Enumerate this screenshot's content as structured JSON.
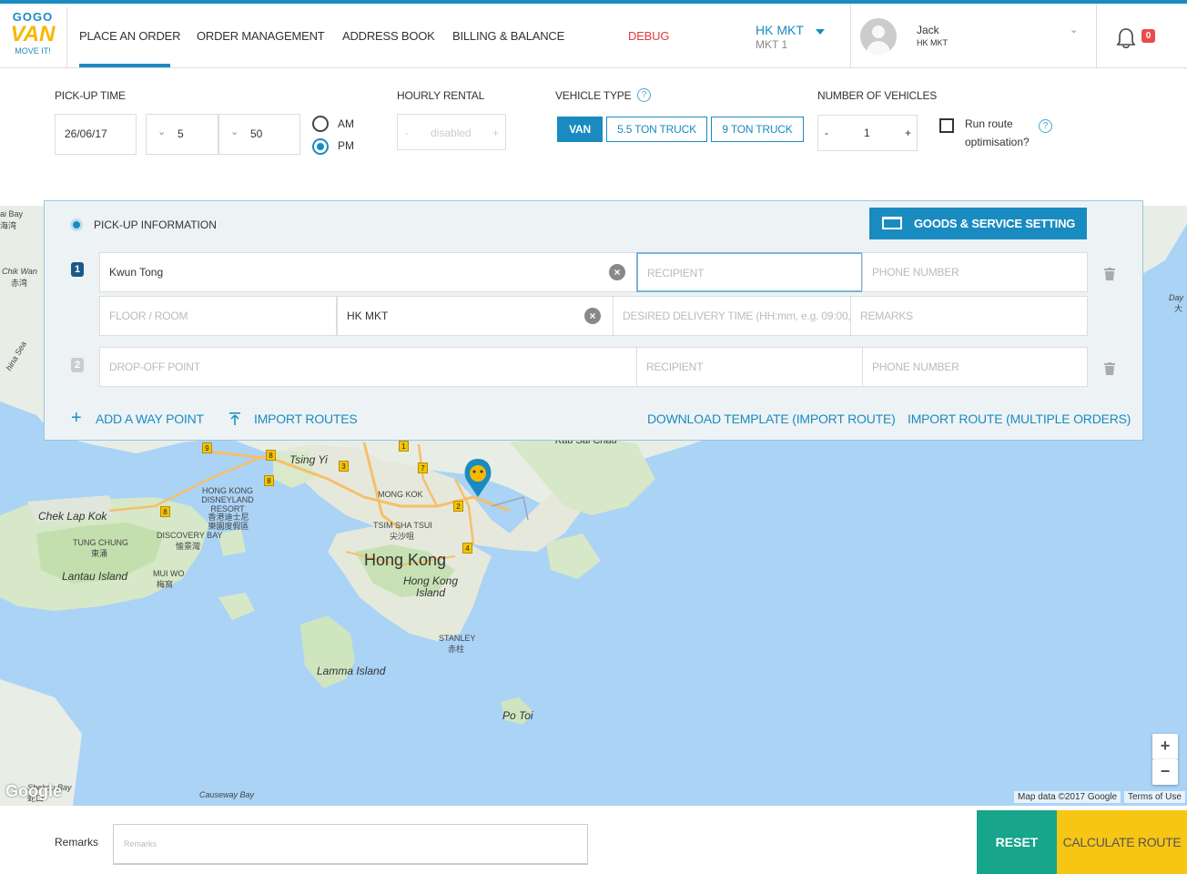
{
  "header": {
    "logo": {
      "line1": "GOGO",
      "line2": "VAN",
      "line3": "MOVE IT!"
    },
    "nav": [
      {
        "label": "PLACE AN ORDER"
      },
      {
        "label": "ORDER MANAGEMENT"
      },
      {
        "label": "ADDRESS BOOK"
      },
      {
        "label": "BILLING & BALANCE"
      },
      {
        "label": "DEBUG"
      }
    ],
    "market": {
      "name": "HK MKT",
      "sub": "MKT 1"
    },
    "user": {
      "name": "Jack",
      "sub": "HK MKT"
    },
    "notifications": "0"
  },
  "order_form": {
    "pickup_time": {
      "label": "PICK-UP TIME",
      "date": "26/06/17",
      "hour": "5",
      "minute": "50",
      "am_label": "AM",
      "pm_label": "PM",
      "selected": "PM"
    },
    "hourly_rental": {
      "label": "HOURLY RENTAL",
      "minus": "-",
      "value": "disabled",
      "plus": "+"
    },
    "vehicle_type": {
      "label": "VEHICLE TYPE",
      "options": [
        {
          "label": "VAN",
          "selected": true
        },
        {
          "label": "5.5 TON TRUCK",
          "selected": false
        },
        {
          "label": "9 TON TRUCK",
          "selected": false
        }
      ]
    },
    "vehicles": {
      "label": "NUMBER OF VEHICLES",
      "minus": "-",
      "value": "1",
      "plus": "+"
    },
    "route_opt": {
      "line1": "Run route",
      "line2": "optimisation?",
      "checked": false
    },
    "help": "?"
  },
  "pickup_panel": {
    "title": "PICK-UP INFORMATION",
    "goods_button": "GOODS & SERVICE SETTING",
    "stop1": {
      "number": "1",
      "address": "Kwun Tong",
      "recipient_placeholder": "RECIPIENT",
      "phone_placeholder": "PHONE NUMBER",
      "floor_placeholder": "FLOOR / ROOM",
      "region": "HK MKT",
      "time_placeholder": "DESIRED DELIVERY TIME (HH:mm, e.g. 09:00,",
      "remarks_placeholder": "REMARKS"
    },
    "stop2": {
      "number": "2",
      "address_placeholder": "DROP-OFF POINT",
      "recipient_placeholder": "RECIPIENT",
      "phone_placeholder": "PHONE NUMBER"
    },
    "links": {
      "add_way_point": "ADD A WAY POINT",
      "import_routes": "IMPORT ROUTES",
      "download_template": "DOWNLOAD TEMPLATE (IMPORT ROUTE)",
      "import_multiple": "IMPORT ROUTE (MULTIPLE ORDERS)"
    }
  },
  "map": {
    "labels": {
      "kau_sai_chau": "Kau Sai Chau",
      "tsing_yi": "Tsing Yi",
      "mong_kok": "MONG KOK",
      "hk_disneyland": "HONG KONG DISNEYLAND RESORT",
      "hk_disneyland_zh": "香港迪士尼樂園度假區",
      "chek_lap_kok": "Chek Lap Kok",
      "discovery_bay": "DISCOVERY BAY",
      "discovery_bay_zh": "愉景灣",
      "tung_chung": "TUNG CHUNG",
      "tung_chung_zh": "東涌",
      "tsim_sha_tsui": "TSIM SHA TSUI",
      "tsim_sha_tsui_zh": "尖沙咀",
      "hong_kong": "Hong Kong",
      "hong_kong_island": "Hong Kong Island",
      "lantau_island": "Lantau Island",
      "mui_wo": "MUI WO",
      "mui_wo_zh": "梅窩",
      "stanley": "STANLEY",
      "stanley_zh": "赤柱",
      "lamma_island": "Lamma Island",
      "po_toi": "Po Toi",
      "chik_wan": "Chik Wan",
      "chik_wan_zh": "赤湾",
      "ai_bay": "ai Bay",
      "ai_bay_zh": "海湾",
      "china_sea": "hina Sea",
      "day_right": "Day",
      "day_right_zh": "大",
      "shekou_bay": "Shekou Bay",
      "shekou_zh": "蛇口",
      "causeway_bay": "Causeway Bay"
    },
    "road_numbers": [
      "9",
      "8",
      "3",
      "7",
      "1",
      "2",
      "4",
      "8",
      "8"
    ],
    "zoom_in": "+",
    "zoom_out": "−",
    "attribution": "Map data ©2017 Google",
    "terms": "Terms of Use",
    "google": "Google"
  },
  "footer": {
    "remarks_label": "Remarks",
    "remarks_placeholder": "Remarks",
    "reset": "RESET",
    "calculate": "CALCULATE ROUTE"
  },
  "colors": {
    "primary": "#1a8bc0",
    "accent_yellow": "#f7c614",
    "reset_green": "#17a58c",
    "debug_red": "#e0383e"
  }
}
